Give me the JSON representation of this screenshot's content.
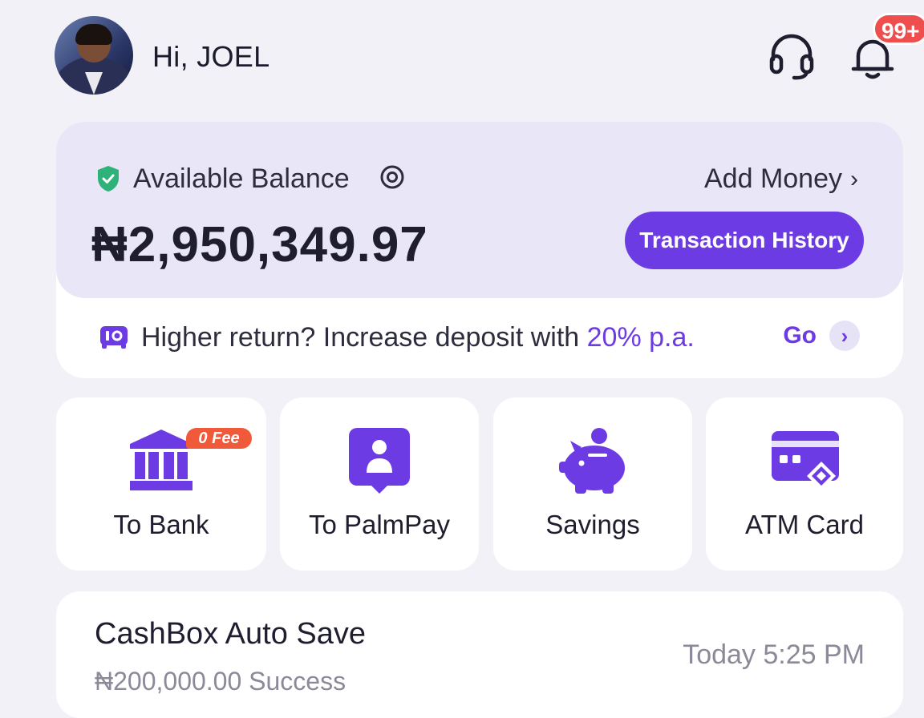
{
  "header": {
    "greeting": "Hi, JOEL",
    "notifications_badge": "99+",
    "icons": [
      "user-avatar",
      "headset-icon",
      "bell-icon"
    ]
  },
  "balance": {
    "label": "Available Balance",
    "amount": "₦2,950,349.97",
    "add_money_label": "Add Money",
    "transaction_history_label": "Transaction History",
    "icons": [
      "shield-check-icon",
      "eye-icon",
      "chevron-right-icon"
    ]
  },
  "promo": {
    "text_prefix": "Higher return? Increase deposit with ",
    "highlight": "20% p.a.",
    "go_label": "Go"
  },
  "actions": [
    {
      "label": "To Bank",
      "icon": "bank-icon",
      "badge": "0 Fee"
    },
    {
      "label": "To PalmPay",
      "icon": "palmpay-contact-icon"
    },
    {
      "label": "Savings",
      "icon": "piggy-bank-icon"
    },
    {
      "label": "ATM Card",
      "icon": "atm-card-icon"
    }
  ],
  "recent": {
    "title": "CashBox Auto Save",
    "subtitle": "₦200,000.00 Success",
    "time": "Today 5:25 PM"
  },
  "colors": {
    "accent": "#6c3be4",
    "background": "#f2f1f7",
    "balance_card": "#e9e6f7",
    "badge_red": "#ef4e4e",
    "fee_orange": "#f05a3a",
    "shield_green": "#2fb27a"
  }
}
